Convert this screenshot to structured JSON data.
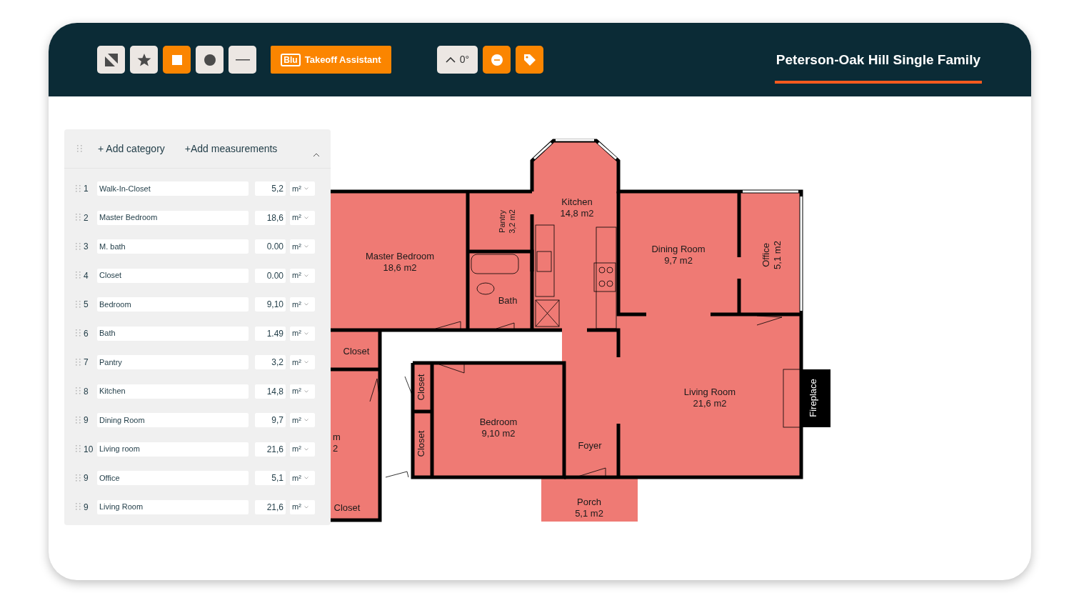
{
  "toolbar": {
    "tools": [
      {
        "kind": "pointer",
        "selected": false
      },
      {
        "kind": "star",
        "selected": false
      },
      {
        "kind": "square",
        "selected": true
      },
      {
        "kind": "circle",
        "selected": false
      },
      {
        "kind": "line",
        "selected": false
      }
    ],
    "assistant": {
      "badge": "Blu",
      "label": "Takeoff Assistant"
    },
    "angle": {
      "label": "0°"
    },
    "title": "Peterson-Oak Hill Single Family"
  },
  "panel": {
    "add_category": "+ Add category",
    "add_measurements": "+Add measurements",
    "expanded": true,
    "rows": [
      {
        "number": "1",
        "name": "Walk-In-Closet",
        "value": "5,2",
        "unit": "m²"
      },
      {
        "number": "2",
        "name": "Master Bedroom",
        "value": "18,6",
        "unit": "m²"
      },
      {
        "number": "3",
        "name": "M. bath",
        "value": "0.00",
        "unit": "m²"
      },
      {
        "number": "4",
        "name": "Closet",
        "value": "0.00",
        "unit": "m²"
      },
      {
        "number": "5",
        "name": "Bedroom",
        "value": "9,10",
        "unit": "m²"
      },
      {
        "number": "6",
        "name": "Bath",
        "value": "1.49",
        "unit": "m²"
      },
      {
        "number": "7",
        "name": "Pantry",
        "value": "3,2",
        "unit": "m²"
      },
      {
        "number": "8",
        "name": "Kitchen",
        "value": "14,8",
        "unit": "m²"
      },
      {
        "number": "9",
        "name": "Dining Room",
        "value": "9,7",
        "unit": "m²"
      },
      {
        "number": "10",
        "name": "Living room",
        "value": "21,6",
        "unit": "m²"
      },
      {
        "number": "9",
        "name": "Office",
        "value": "5,1",
        "unit": "m²"
      },
      {
        "number": "9",
        "name": "Living Room",
        "value": "21,6",
        "unit": "m²"
      }
    ]
  },
  "plan": {
    "labels": [
      {
        "lines": [
          "Kitchen",
          "14,8 m2"
        ]
      },
      {
        "lines": [
          "Pantry",
          "3,2 m2"
        ]
      },
      {
        "lines": [
          "Master Bedroom",
          "18,6 m2"
        ]
      },
      {
        "lines": [
          "Bath"
        ]
      },
      {
        "lines": [
          "Dining Room",
          "9,7 m2"
        ]
      },
      {
        "lines": [
          "Office",
          "5,1 m2"
        ]
      },
      {
        "lines": [
          "Closet"
        ]
      },
      {
        "lines": [
          "Closet"
        ]
      },
      {
        "lines": [
          "Closet"
        ]
      },
      {
        "lines": [
          "Bedroom",
          "9,10 m2"
        ]
      },
      {
        "lines": [
          "m",
          "2"
        ]
      },
      {
        "lines": [
          "Living Room",
          "21,6 m2"
        ]
      },
      {
        "lines": [
          "Foyer"
        ]
      },
      {
        "lines": [
          "Closet"
        ]
      },
      {
        "lines": [
          "Porch",
          "5,1 m2"
        ]
      },
      {
        "lines": [
          "Fireplace"
        ]
      }
    ]
  }
}
